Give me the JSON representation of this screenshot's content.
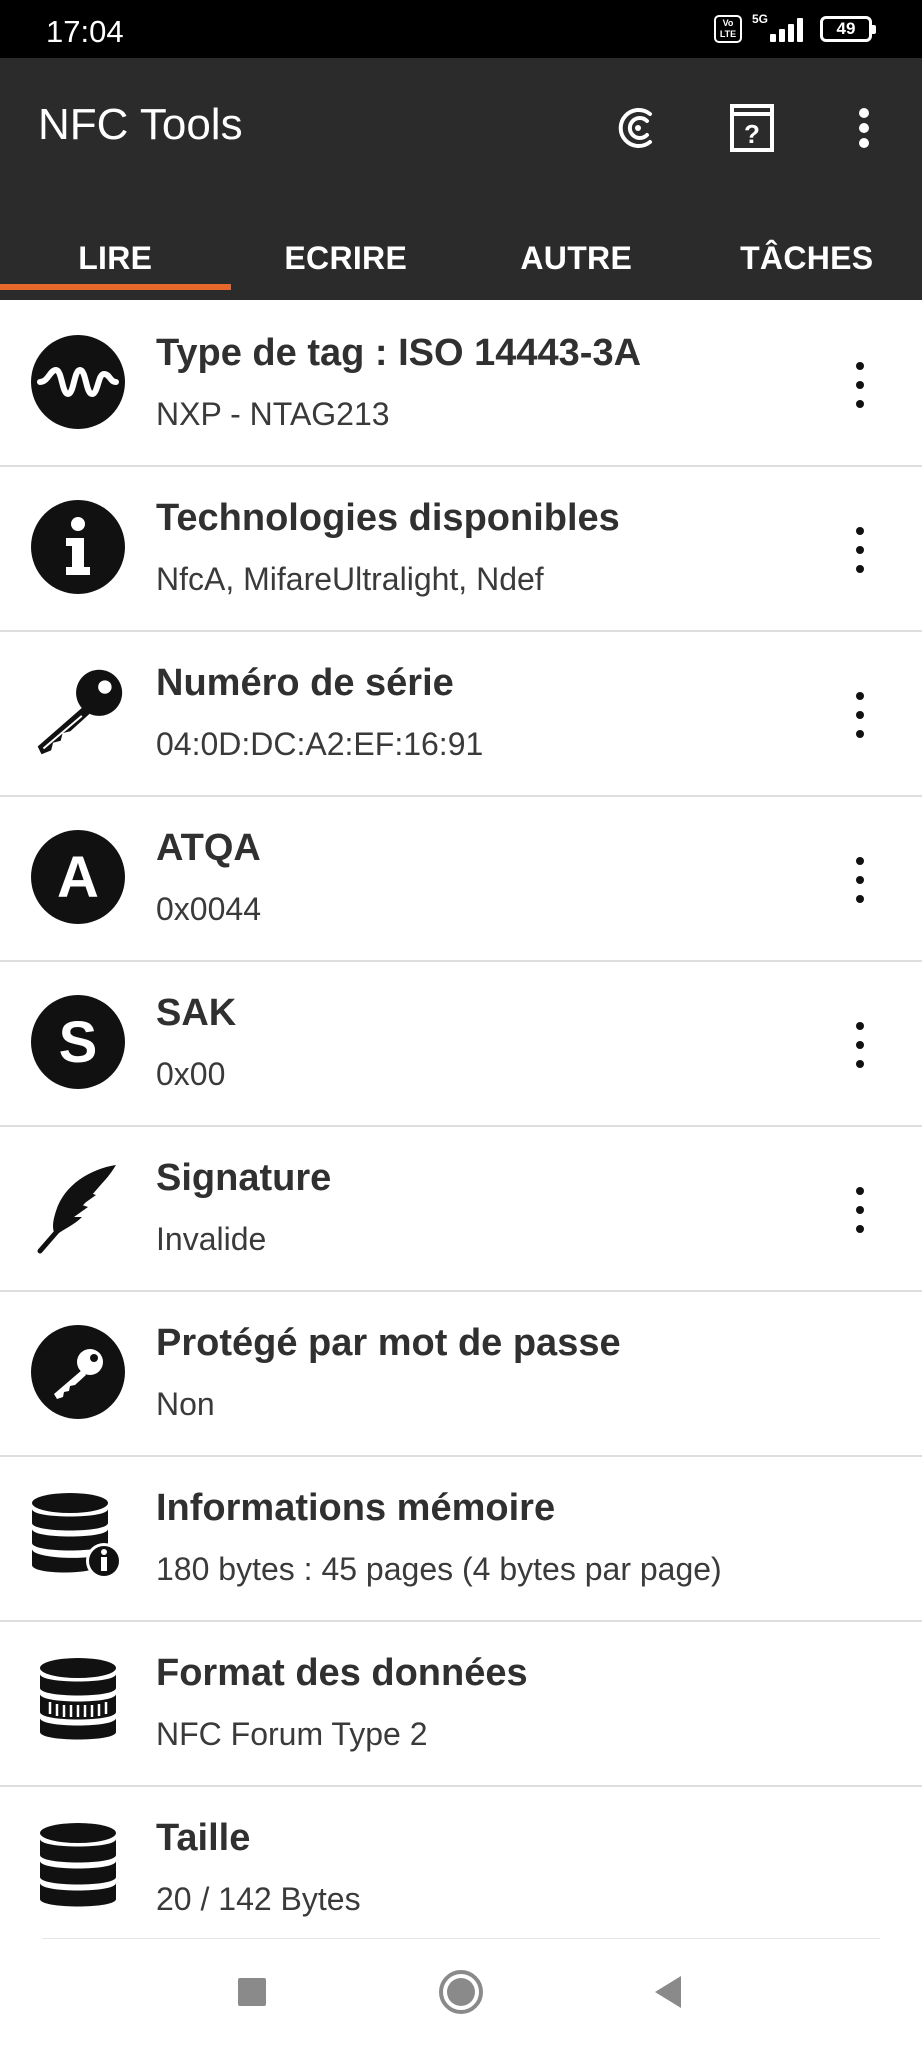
{
  "status": {
    "time": "17:04",
    "volte": "Vo LTE",
    "network": "5G",
    "battery": "49"
  },
  "appbar": {
    "title": "NFC Tools",
    "icons": [
      "history-icon",
      "help-book-icon",
      "more-vert-icon"
    ]
  },
  "tabs": [
    {
      "label": "LIRE",
      "active": true
    },
    {
      "label": "ECRIRE",
      "active": false
    },
    {
      "label": "AUTRE",
      "active": false
    },
    {
      "label": "TÂCHES",
      "active": false
    }
  ],
  "rows": [
    {
      "icon": "wave-icon",
      "title": "Type de tag : ISO 14443-3A",
      "subtitle": "NXP - NTAG213",
      "menu": true
    },
    {
      "icon": "info-icon",
      "title": "Technologies disponibles",
      "subtitle": "NfcA, MifareUltralight, Ndef",
      "menu": true
    },
    {
      "icon": "key-icon",
      "title": "Numéro de série",
      "subtitle": "04:0D:DC:A2:EF:16:91",
      "menu": true
    },
    {
      "icon": "letter-a-icon",
      "title": "ATQA",
      "subtitle": "0x0044",
      "menu": true
    },
    {
      "icon": "letter-s-icon",
      "title": "SAK",
      "subtitle": "0x00",
      "menu": true
    },
    {
      "icon": "feather-icon",
      "title": "Signature",
      "subtitle": "Invalide",
      "menu": true
    },
    {
      "icon": "key-circle-icon",
      "title": "Protégé par mot de passe",
      "subtitle": "Non",
      "menu": false
    },
    {
      "icon": "database-info-icon",
      "title": "Informations mémoire",
      "subtitle": "180 bytes : 45 pages (4 bytes par page)",
      "menu": false
    },
    {
      "icon": "database-striped-icon",
      "title": "Format des données",
      "subtitle": "NFC Forum Type 2",
      "menu": false
    },
    {
      "icon": "database-icon",
      "title": "Taille",
      "subtitle": "20 / 142 Bytes",
      "menu": false
    }
  ],
  "navbar": {
    "buttons": [
      "recents-button",
      "home-button",
      "back-button"
    ]
  },
  "colors": {
    "appbar": "#2b2b2b",
    "accent": "#e8682b",
    "text": "#303030"
  }
}
